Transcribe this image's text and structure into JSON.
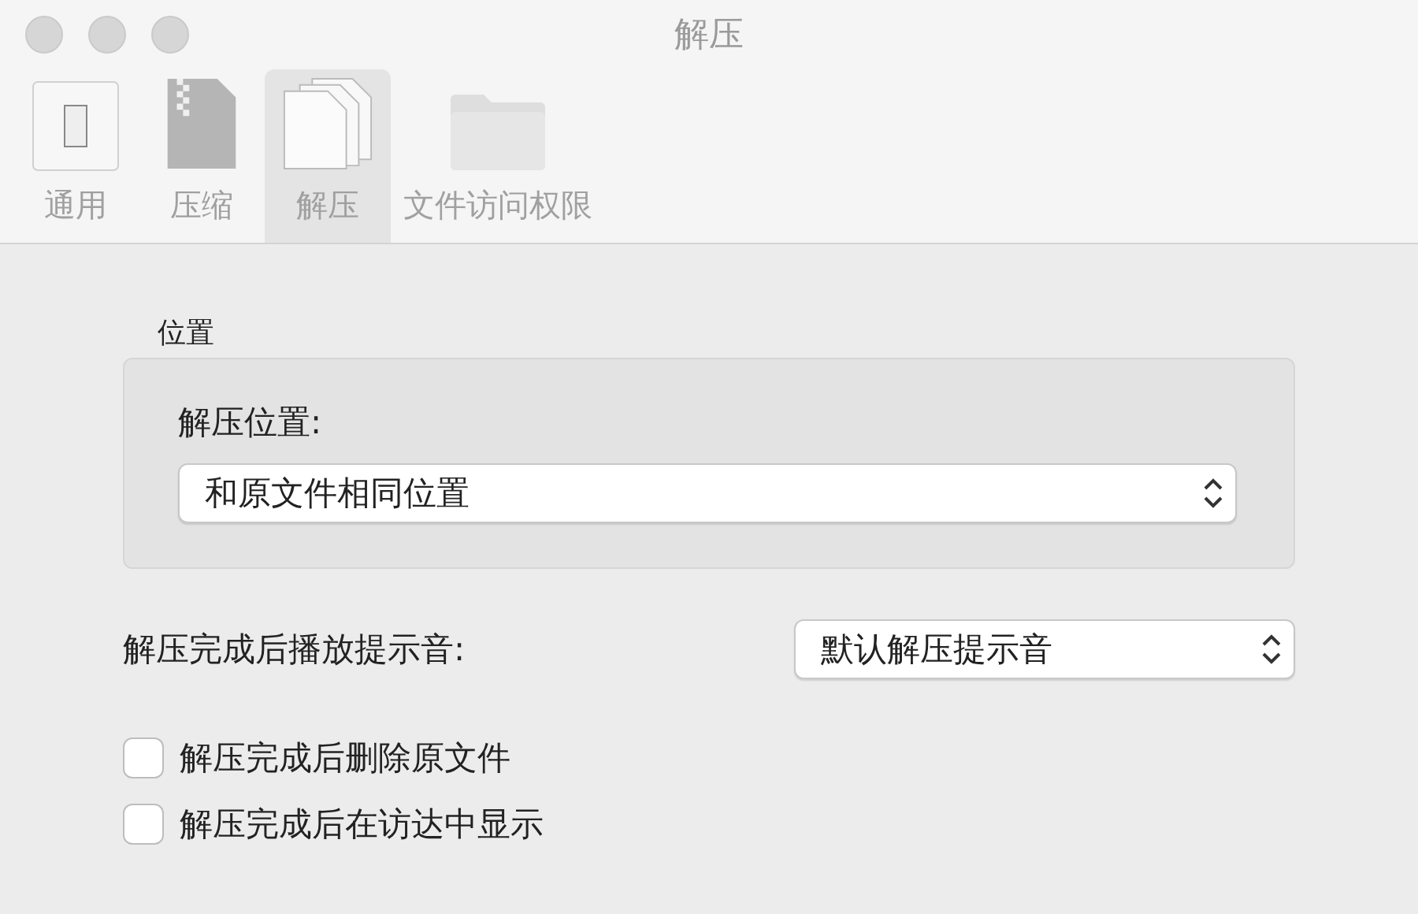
{
  "window": {
    "title": "解压"
  },
  "tabs": [
    {
      "label": "通用",
      "kind": "switch",
      "selected": false
    },
    {
      "label": "压缩",
      "kind": "zip",
      "selected": false
    },
    {
      "label": "解压",
      "kind": "documents",
      "selected": true
    },
    {
      "label": "文件访问权限",
      "kind": "folder",
      "selected": false
    }
  ],
  "location_group": {
    "title": "位置",
    "label": "解压位置:",
    "popup": {
      "value": "和原文件相同位置"
    }
  },
  "sound": {
    "label": "解压完成后播放提示音:",
    "popup": {
      "value": "默认解压提示音"
    }
  },
  "checkboxes": [
    {
      "label": "解压完成后删除原文件",
      "checked": false
    },
    {
      "label": "解压完成后在访达中显示",
      "checked": false
    }
  ]
}
